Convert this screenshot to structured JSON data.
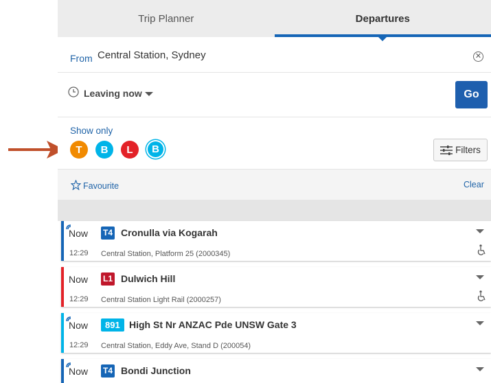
{
  "tabs": [
    {
      "label": "Trip Planner",
      "active": false
    },
    {
      "label": "Departures",
      "active": true
    }
  ],
  "from": {
    "label": "From",
    "value": "Central Station, Sydney",
    "clear_icon": "close-circle-icon"
  },
  "leaving": {
    "label": "Leaving now",
    "go_label": "Go"
  },
  "show_only": {
    "label": "Show only",
    "modes": [
      {
        "letter": "T",
        "name": "trains",
        "color": "#f18a00"
      },
      {
        "letter": "B",
        "name": "buses",
        "color": "#00b4e8"
      },
      {
        "letter": "L",
        "name": "light-rail",
        "color": "#e32228"
      },
      {
        "letter": "B",
        "name": "school-buses",
        "color": "#00b4e8"
      }
    ],
    "filters_label": "Filters"
  },
  "favourite": {
    "label": "Favourite",
    "clear_label": "Clear"
  },
  "departures": [
    {
      "when": "Now",
      "time": "12:29",
      "route": "T4",
      "destination": "Cronulla via Kogarah",
      "stop": "Central Station, Platform 25 (2000345)",
      "realtime": true,
      "accessible": true,
      "color": "#1565b6"
    },
    {
      "when": "Now",
      "time": "12:29",
      "route": "L1",
      "destination": "Dulwich Hill",
      "stop": "Central Station Light Rail (2000257)",
      "realtime": false,
      "accessible": true,
      "color": "#e32228"
    },
    {
      "when": "Now",
      "time": "12:29",
      "route": "891",
      "destination": "High St Nr ANZAC Pde UNSW Gate 3",
      "stop": "Central Station, Eddy Ave, Stand D (200054)",
      "realtime": true,
      "accessible": false,
      "color": "#00b4e8"
    },
    {
      "when": "Now",
      "time": "",
      "route": "T4",
      "destination": "Bondi Junction",
      "stop": "",
      "realtime": true,
      "accessible": false,
      "color": "#1565b6"
    }
  ]
}
